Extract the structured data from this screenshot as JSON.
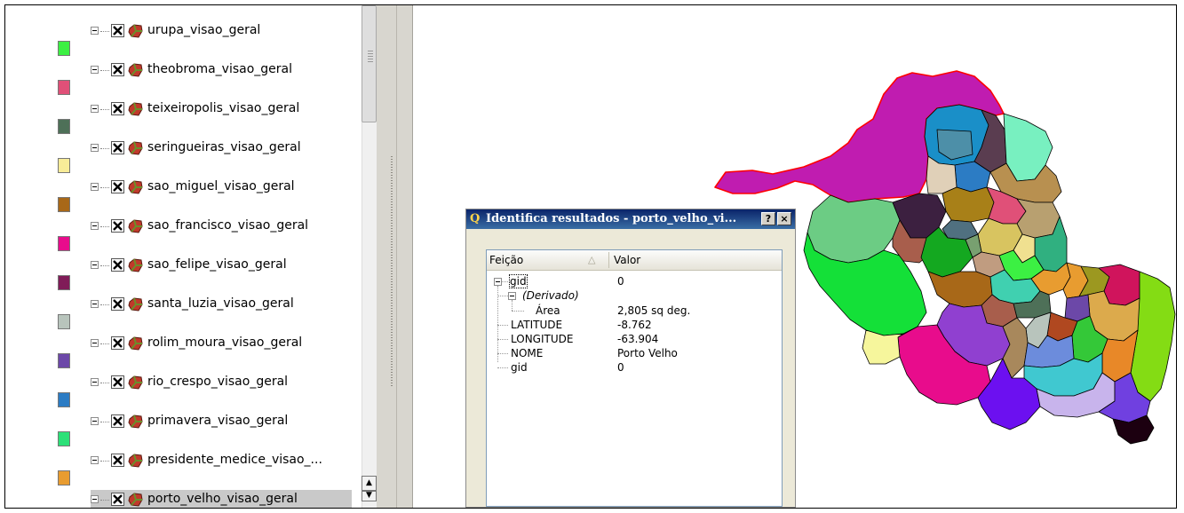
{
  "layers": [
    {
      "name": "urupa_visao_geral",
      "color": "#3cf043"
    },
    {
      "name": "theobroma_visao_geral",
      "color": "#e05078"
    },
    {
      "name": "teixeiropolis_visao_geral",
      "color": "#4e7058"
    },
    {
      "name": "seringueiras_visao_geral",
      "color": "#f8ec98"
    },
    {
      "name": "sao_miguel_visao_geral",
      "color": "#a86818"
    },
    {
      "name": "sao_francisco_visao_geral",
      "color": "#e80c8c"
    },
    {
      "name": "sao_felipe_visao_geral",
      "color": "#801c58"
    },
    {
      "name": "santa_luzia_visao_geral",
      "color": "#b8c4bc"
    },
    {
      "name": "rolim_moura_visao_geral",
      "color": "#6c48a8"
    },
    {
      "name": "rio_crespo_visao_geral",
      "color": "#2c7cc4"
    },
    {
      "name": "primavera_visao_geral",
      "color": "#2ce078"
    },
    {
      "name": "presidente_medice_visao_...",
      "color": "#e89c30"
    },
    {
      "name": "porto_velho_visao_geral",
      "color": "#c01cb0",
      "selected": true
    }
  ],
  "dialog": {
    "title": "Identifica resultados - porto_velho_vi...",
    "help_label": "?",
    "close_label": "×",
    "columns": {
      "feature": "Feição",
      "value": "Valor"
    },
    "root": {
      "feature": "gid",
      "value": "0"
    },
    "derived_label": "(Derivado)",
    "area": {
      "feature": "Área",
      "value": "2,805 sq deg."
    },
    "attributes": [
      {
        "feature": "LATITUDE",
        "value": "-8.762"
      },
      {
        "feature": "LONGITUDE",
        "value": "-63.904"
      },
      {
        "feature": "NOME",
        "value": "Porto Velho"
      },
      {
        "feature": "gid",
        "value": "0"
      }
    ]
  },
  "map": {
    "highlight_color": "#ff0000",
    "selected_fill": "#c01cb0"
  }
}
